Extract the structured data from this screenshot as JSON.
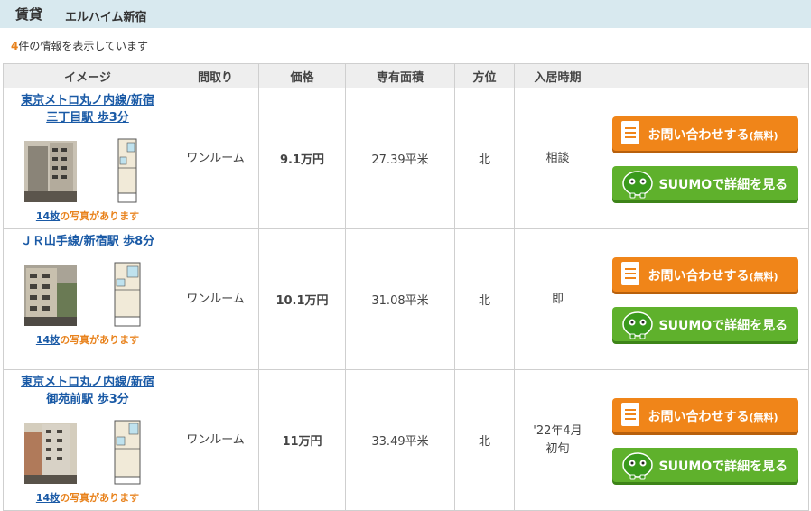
{
  "header": {
    "category": "賃貸",
    "building": "エルハイム新宿"
  },
  "result": {
    "count": "4",
    "suffix": "件の情報を表示しています"
  },
  "table": {
    "columns": [
      "イメージ",
      "間取り",
      "価格",
      "専有面積",
      "方位",
      "入居時期",
      ""
    ]
  },
  "listings": [
    {
      "station": "東京メトロ丸ノ内線/新宿三丁目駅 歩3分",
      "photos_count": "14枚",
      "photos_suffix": "の写真があります",
      "layout": "ワンルーム",
      "price": "9.1万円",
      "area": "27.39平米",
      "direction": "北",
      "move_in": "相談"
    },
    {
      "station": "ＪＲ山手線/新宿駅 歩8分",
      "photos_count": "14枚",
      "photos_suffix": "の写真があります",
      "layout": "ワンルーム",
      "price": "10.1万円",
      "area": "31.08平米",
      "direction": "北",
      "move_in": "即"
    },
    {
      "station": "東京メトロ丸ノ内線/新宿御苑前駅 歩3分",
      "photos_count": "14枚",
      "photos_suffix": "の写真があります",
      "layout": "ワンルーム",
      "price": "11万円",
      "area": "33.49平米",
      "direction": "北",
      "move_in": "'22年4月初旬"
    }
  ],
  "buttons": {
    "inquiry": "お問い合わせする",
    "inquiry_note": "(無料)",
    "suumo": "SUUMOで詳細を見る"
  },
  "colors": {
    "accent": "#e8821c",
    "link": "#1a5aa6",
    "inquiry_btn": "#f08519",
    "suumo_btn": "#5fb12c",
    "header_bg": "#d8e9ef"
  }
}
